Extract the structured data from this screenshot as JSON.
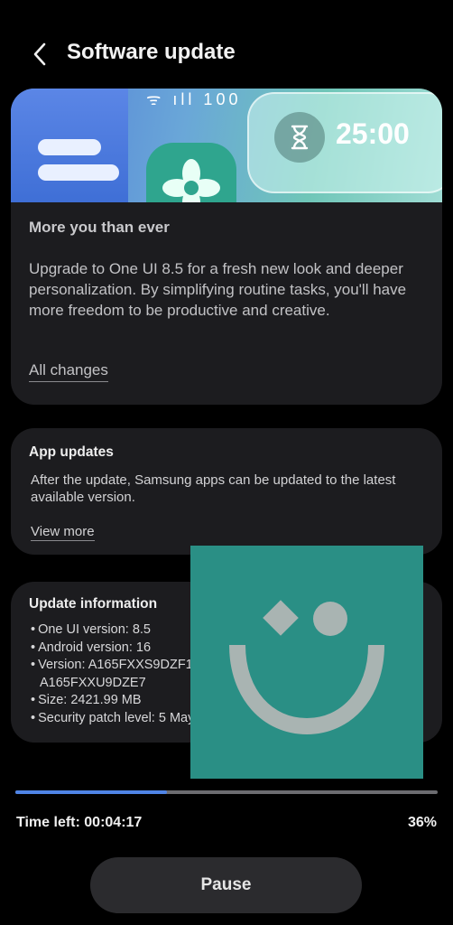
{
  "header": {
    "title": "Software update",
    "back_icon": "chevron-left-icon"
  },
  "banner": {
    "widget_time": "25:00",
    "status_glyphs": "ᯤ ıll 100",
    "widget_icon": "hourglass-icon",
    "app_icon": "flower-icon"
  },
  "main_card": {
    "subtitle": "More you than ever",
    "description": "Upgrade to One UI 8.5 for a fresh new look and deeper personalization. By simplifying routine tasks, you'll have more freedom to be productive and creative.",
    "all_changes_label": "All changes"
  },
  "app_updates": {
    "heading": "App updates",
    "description": "After the update, Samsung apps can be updated to the latest available version.",
    "view_more_label": "View more"
  },
  "update_info": {
    "heading": "Update information",
    "one_ui": "One UI version: 8.5",
    "android": "Android version: 16",
    "version_line1": "Version: A165FXXS9DZF1 / A165FOJM9DZE7 /",
    "version_line2": "A165FXXU9DZE7",
    "size": "Size: 2421.99 MB",
    "security": "Security patch level: 5 May 2026"
  },
  "progress": {
    "percent_value": 36,
    "percent_label": "36%",
    "time_left": "Time left: 00:04:17"
  },
  "actions": {
    "pause_label": "Pause"
  },
  "colors": {
    "accent": "#4f84e6",
    "overlay": "#2a8f85",
    "card_bg": "#1c1c1f"
  }
}
